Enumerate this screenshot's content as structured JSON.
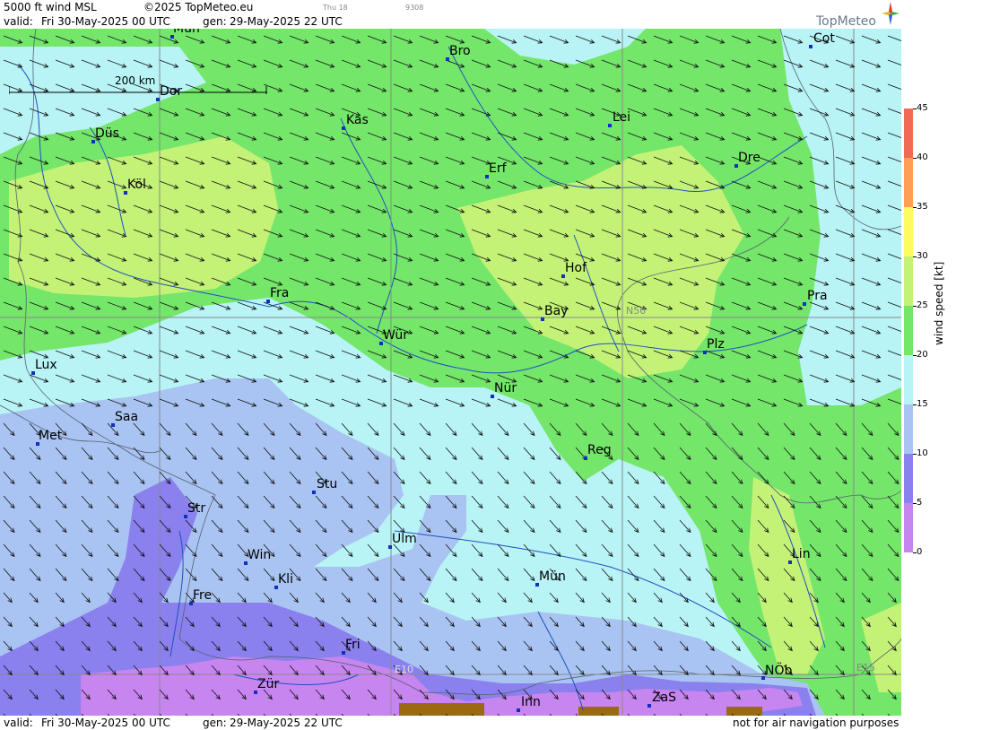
{
  "header": {
    "title": "5000 ft wind MSL",
    "copyright": "©2025 TopMeteo.eu",
    "small_a": "Thu 18",
    "small_b": "9308",
    "valid_label": "valid:",
    "valid_value": "Fri  30-May-2025  00 UTC",
    "gen_label": "gen:",
    "gen_value": "29-May-2025 22 UTC"
  },
  "footer": {
    "valid_label": "valid:",
    "valid_value": "Fri  30-May-2025  00 UTC",
    "gen_label": "gen:",
    "gen_value": "29-May-2025 22 UTC",
    "disclaimer": "not for air navigation purposes"
  },
  "logo": {
    "text": "TopMeteo",
    "icon": "compass-star-icon"
  },
  "scale": {
    "label": "200 km"
  },
  "grid_labels": {
    "lat": "N50",
    "lon_a": "E10",
    "lon_b": "E15"
  },
  "legend": {
    "title": "wind speed [kt]",
    "ticks": [
      "45",
      "40",
      "35",
      "30",
      "25",
      "20",
      "15",
      "10",
      "5",
      "0"
    ],
    "colors": {
      "c0": "#c785f0",
      "c5": "#8a80ee",
      "c10": "#a9c4f2",
      "c15": "#b8f3f5",
      "c20": "#74e66a",
      "c25": "#c3f277",
      "c30": "#fffa60",
      "c35": "#ffd14d",
      "c40": "#ff9f55",
      "c45": "#f06a55"
    }
  },
  "cities": [
    {
      "id": "mun",
      "name": "Mün"
    },
    {
      "id": "bro",
      "name": "Bro"
    },
    {
      "id": "cot",
      "name": "Cot"
    },
    {
      "id": "dor",
      "name": "Dor"
    },
    {
      "id": "kas",
      "name": "Kas"
    },
    {
      "id": "lei",
      "name": "Lei"
    },
    {
      "id": "dus",
      "name": "Düs"
    },
    {
      "id": "erf",
      "name": "Erf"
    },
    {
      "id": "dre",
      "name": "Dre"
    },
    {
      "id": "kol",
      "name": "Köl"
    },
    {
      "id": "hof",
      "name": "Hof"
    },
    {
      "id": "fra",
      "name": "Fra"
    },
    {
      "id": "pra",
      "name": "Pra"
    },
    {
      "id": "bay",
      "name": "Bay"
    },
    {
      "id": "wur",
      "name": "Wür"
    },
    {
      "id": "plz",
      "name": "Plz"
    },
    {
      "id": "lux",
      "name": "Lux"
    },
    {
      "id": "nur",
      "name": "Nür"
    },
    {
      "id": "saa",
      "name": "Saa"
    },
    {
      "id": "met",
      "name": "Met"
    },
    {
      "id": "reg",
      "name": "Reg"
    },
    {
      "id": "stu",
      "name": "Stu"
    },
    {
      "id": "str",
      "name": "Str"
    },
    {
      "id": "ulm",
      "name": "Ulm"
    },
    {
      "id": "win",
      "name": "Win"
    },
    {
      "id": "lin",
      "name": "Lin"
    },
    {
      "id": "mue",
      "name": "Mün"
    },
    {
      "id": "kli",
      "name": "Kli"
    },
    {
      "id": "fre",
      "name": "Fre"
    },
    {
      "id": "fri",
      "name": "Fri"
    },
    {
      "id": "nob",
      "name": "NÖb"
    },
    {
      "id": "zur",
      "name": "Zür"
    },
    {
      "id": "zas",
      "name": "ZaS"
    },
    {
      "id": "inn",
      "name": "Inn"
    }
  ]
}
